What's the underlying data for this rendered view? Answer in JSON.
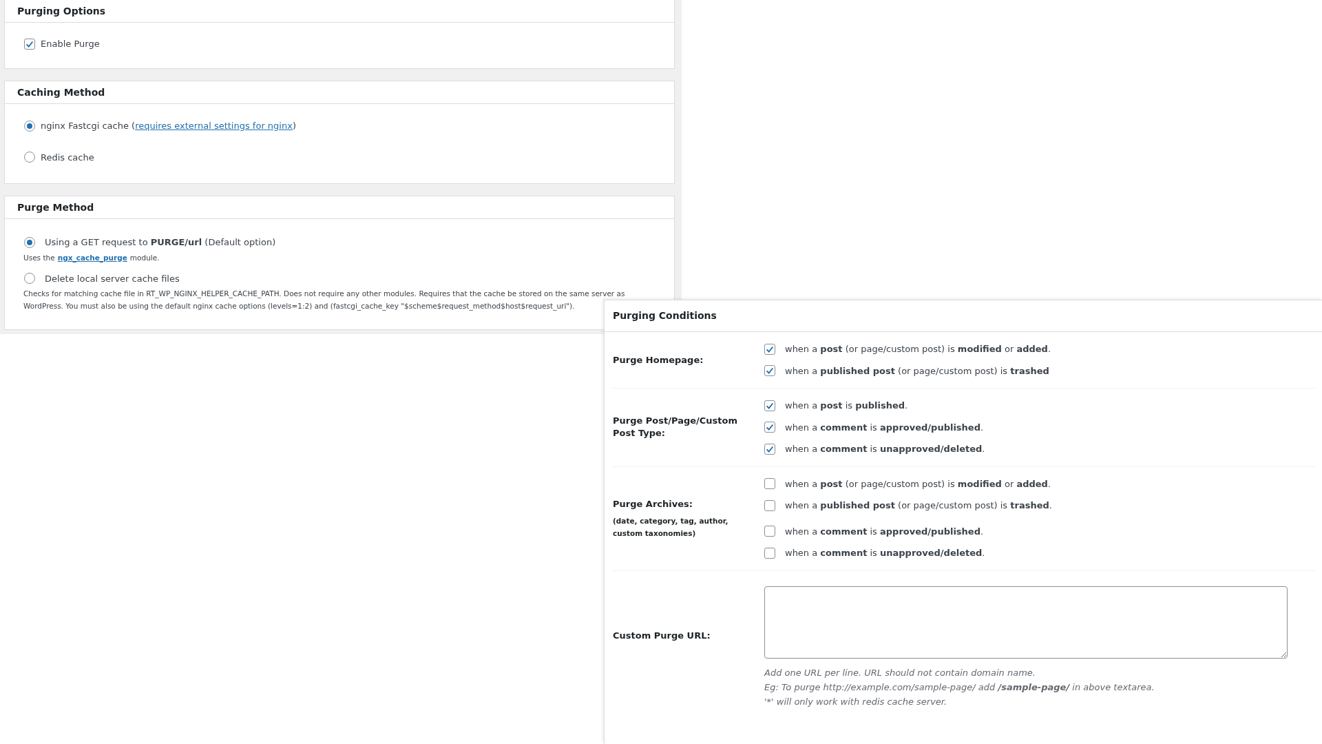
{
  "purging_options": {
    "title": "Purging Options",
    "enable_purge": {
      "label": "Enable Purge",
      "checked": true
    }
  },
  "caching_method": {
    "title": "Caching Method",
    "options": [
      {
        "label": "nginx Fastcgi cache (",
        "link": "requires external settings for nginx",
        "label_after": ")",
        "selected": true
      },
      {
        "label": "Redis cache",
        "selected": false
      }
    ]
  },
  "purge_method": {
    "title": "Purge Method",
    "options": [
      {
        "label": "Using a GET request to **PURGE/url** (Default option)",
        "selected": true,
        "description": "Uses the",
        "description_link": "ngx_cache_purge",
        "description_after": "module."
      },
      {
        "label": "Delete local server cache files",
        "selected": false,
        "description": "Checks for matching cache file in RT_WP_NGINX_HELPER_CACHE_PATH. Does not require any other modules. Requires that the cache be stored on the same server as WordPress. You must also be using the default nginx cache options (levels=1:2) and (fastcgi_cache_key \"$scheme$request_method$host$request_uri\")."
      }
    ]
  },
  "purging_conditions": {
    "title": "Purging Conditions",
    "sections": [
      {
        "label": "Purge Homepage:",
        "groups": [
          [
            {
              "text": "when a **post** (or page/custom post) is **modified** or **added**.",
              "checked": true
            },
            {
              "text": "when a **published post** (or page/custom post) is **trashed**",
              "checked": true
            }
          ]
        ]
      },
      {
        "label": "Purge Post/Page/Custom Post Type:",
        "groups": [
          [
            {
              "text": "when a **post** is **published**.",
              "checked": true
            },
            {
              "text": "when a **comment** is **approved/published**.",
              "checked": true
            },
            {
              "text": "when a **comment** is **unapproved/deleted**.",
              "checked": true
            }
          ]
        ]
      },
      {
        "label": "Purge Archives:",
        "note": "(date, category, tag, author, custom taxonomies)",
        "groups": [
          [
            {
              "text": "when a **post** (or page/custom post) is **modified** or **added**.",
              "checked": false
            },
            {
              "text": "when a **published post** (or page/custom post) is **trashed**.",
              "checked": false
            }
          ],
          [
            {
              "text": "when a **comment** is **approved/published**.",
              "checked": false
            },
            {
              "text": "when a **comment** is **unapproved/deleted**.",
              "checked": false
            }
          ]
        ]
      }
    ],
    "custom_purge_url": {
      "label": "Custom Purge URL:",
      "help": [
        "Add one URL per line. URL should not contain domain name.",
        "Eg: To purge http://example.com/sample-page/ add **/sample-page/** in above textarea.",
        "'*' will only work with redis cache server."
      ]
    }
  }
}
